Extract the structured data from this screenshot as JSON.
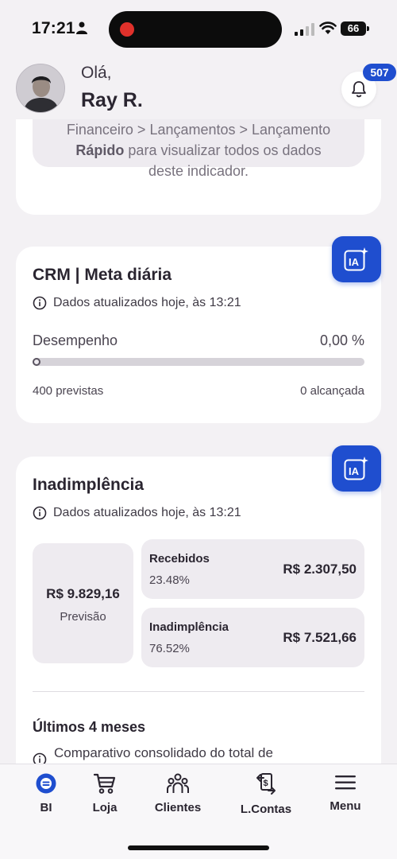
{
  "status_bar": {
    "time": "17:21",
    "battery": "66"
  },
  "header": {
    "greeting": "Olá,",
    "user_name": "Ray R.",
    "notification_count": "507"
  },
  "info_card": {
    "line1": "Financeiro > Lançamentos > Lançamento",
    "line2_bold": "Rápido",
    "line2_rest": " para visualizar todos os dados",
    "line3": "deste indicador."
  },
  "crm_card": {
    "title": "CRM | Meta diária",
    "updated": "Dados atualizados hoje, às 13:21",
    "performance_label": "Desempenho",
    "performance_value": "0,00 %",
    "progress_fraction": 0,
    "planned": "400 previstas",
    "achieved": "0 alcançada",
    "ia_label": "IA"
  },
  "default_card": {
    "title": "Inadimplência",
    "updated": "Dados atualizados hoje, às 13:21",
    "forecast_value": "R$ 9.829,16",
    "forecast_label": "Previsão",
    "received_title": "Recebidos",
    "received_pct": "23.48%",
    "received_value": "R$ 2.307,50",
    "default_title": "Inadimplência",
    "default_pct": "76.52%",
    "default_value": "R$ 7.521,66",
    "last_months_title": "Últimos 4 meses",
    "last_months_desc": "Comparativo consolidado do total de",
    "ia_label": "IA"
  },
  "nav": {
    "items": [
      {
        "label": "BI",
        "icon": "bi-icon"
      },
      {
        "label": "Loja",
        "icon": "cart-icon"
      },
      {
        "label": "Clientes",
        "icon": "people-icon"
      },
      {
        "label": "L.Contas",
        "icon": "transfer-icon"
      },
      {
        "label": "Menu",
        "icon": "hamburger-icon"
      }
    ]
  },
  "colors": {
    "accent": "#1f4ecf",
    "background": "#f3f1f4",
    "card": "#ffffff",
    "tile": "#eeebf0"
  }
}
